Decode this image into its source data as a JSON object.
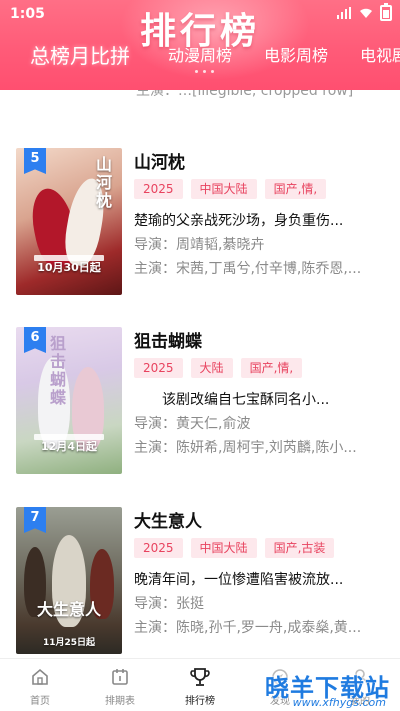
{
  "status": {
    "time": "1:05"
  },
  "header": {
    "banner_title": "排行榜",
    "tabs": [
      {
        "label": "总榜月比拼"
      },
      {
        "label": "动漫周榜"
      },
      {
        "label": "电影周榜"
      },
      {
        "label": "电视剧"
      }
    ],
    "accent": "#ff5b78"
  },
  "list": {
    "cutoff_text": "主演：…[illegible, cropped row]",
    "items": [
      {
        "rank": "5",
        "title": "山河枕",
        "tags": [
          "2025",
          "中国大陆",
          "国产,情,"
        ],
        "description": "楚瑜的父亲战死沙场，身负重伤...",
        "director": "导演：周靖韬,綦晓卉",
        "cast": "主演：宋茜,丁禹兮,付辛博,陈乔恩,...",
        "poster_date": "10月30日起",
        "poster_title": "山河枕"
      },
      {
        "rank": "6",
        "title": "狙击蝴蝶",
        "tags": [
          "2025",
          "大陆",
          "国产,情,"
        ],
        "description": "　　该剧改编自七宝酥同名小...",
        "director": "导演：黄天仁,俞波",
        "cast": "主演：陈妍希,周柯宇,刘芮麟,陈小...",
        "poster_date": "12月4日起",
        "poster_title": "狙击蝴蝶"
      },
      {
        "rank": "7",
        "title": "大生意人",
        "tags": [
          "2025",
          "中国大陆",
          "国产,古装"
        ],
        "description": "晚清年间，一位惨遭陷害被流放...",
        "director": "导演：张挺",
        "cast": "主演：陈晓,孙千,罗一舟,成泰燊,黄...",
        "poster_date": "11月25日起",
        "poster_title": "大生意人"
      }
    ]
  },
  "bottom_nav": {
    "items": [
      {
        "label": "首页",
        "icon": "home-icon"
      },
      {
        "label": "排期表",
        "icon": "calendar-icon"
      },
      {
        "label": "排行榜",
        "icon": "trophy-icon"
      },
      {
        "label": "发现",
        "icon": "discover-icon"
      },
      {
        "label": "我的",
        "icon": "user-icon"
      }
    ]
  },
  "watermark": {
    "text": "晓羊下载站",
    "url": "www.xfhygs.com"
  }
}
